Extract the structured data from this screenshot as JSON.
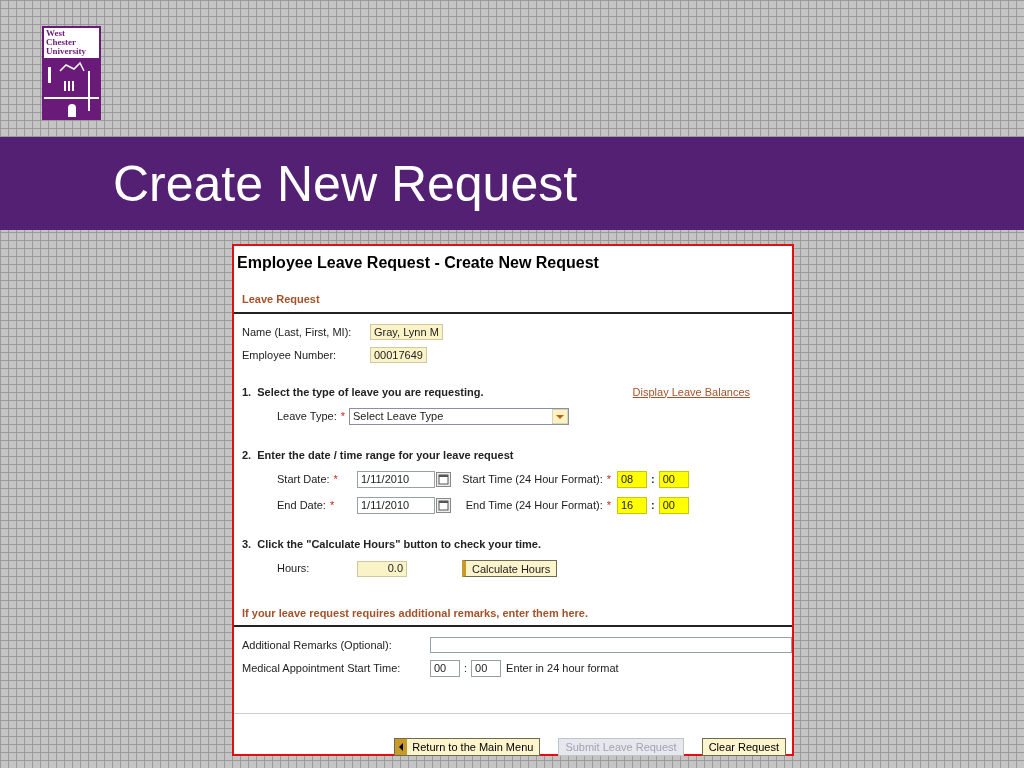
{
  "logo": {
    "lines": [
      "West",
      "Chester",
      "University"
    ]
  },
  "slide_title": "Create New Request",
  "form": {
    "title": "Employee Leave Request - Create New Request",
    "section": "Leave Request",
    "info_fields": [
      {
        "label": "Name (Last, First, MI):",
        "value": "Gray, Lynn M"
      },
      {
        "label": "Employee Number:",
        "value": "00017649"
      }
    ],
    "step1": {
      "heading": "1.  Select the type of leave you are requesting.",
      "link": "Display Leave Balances",
      "label": "Leave Type:",
      "required_mark": "*",
      "value": "Select Leave Type"
    },
    "step2": {
      "heading": "2.  Enter the date / time range for your leave request",
      "rows": [
        {
          "date_label": "Start Date:",
          "required_mark": "*",
          "date": "1/11/2010",
          "time_label": "Start Time (24 Hour Format):",
          "time_required_mark": "*",
          "hour": "08",
          "separator": ":",
          "minute": "00",
          "highlighted": true
        },
        {
          "date_label": "End Date:",
          "required_mark": "*",
          "date": "1/11/2010",
          "time_label": "End Time (24 Hour Format):",
          "time_required_mark": "*",
          "hour": "16",
          "separator": ":",
          "minute": "00",
          "highlighted": true
        }
      ]
    },
    "step3": {
      "heading": "3.  Click the \"Calculate Hours\" button to check your time.",
      "label": "Hours:",
      "value": "0.0",
      "button": "Calculate Hours"
    },
    "remarks_section": "If your leave request requires additional remarks, enter them here.",
    "remarks_label": "Additional Remarks (Optional):",
    "medical": {
      "label": "Medical Appointment Start Time:",
      "hour": "00",
      "separator": ":",
      "minute": "00",
      "hint": "Enter in 24 hour format"
    },
    "buttons": [
      {
        "label": "Return to the Main Menu",
        "kind": "back",
        "disabled": false
      },
      {
        "label": "Submit Leave Request",
        "kind": "plain",
        "disabled": true
      },
      {
        "label": "Clear Request",
        "kind": "plain",
        "disabled": false
      }
    ]
  }
}
